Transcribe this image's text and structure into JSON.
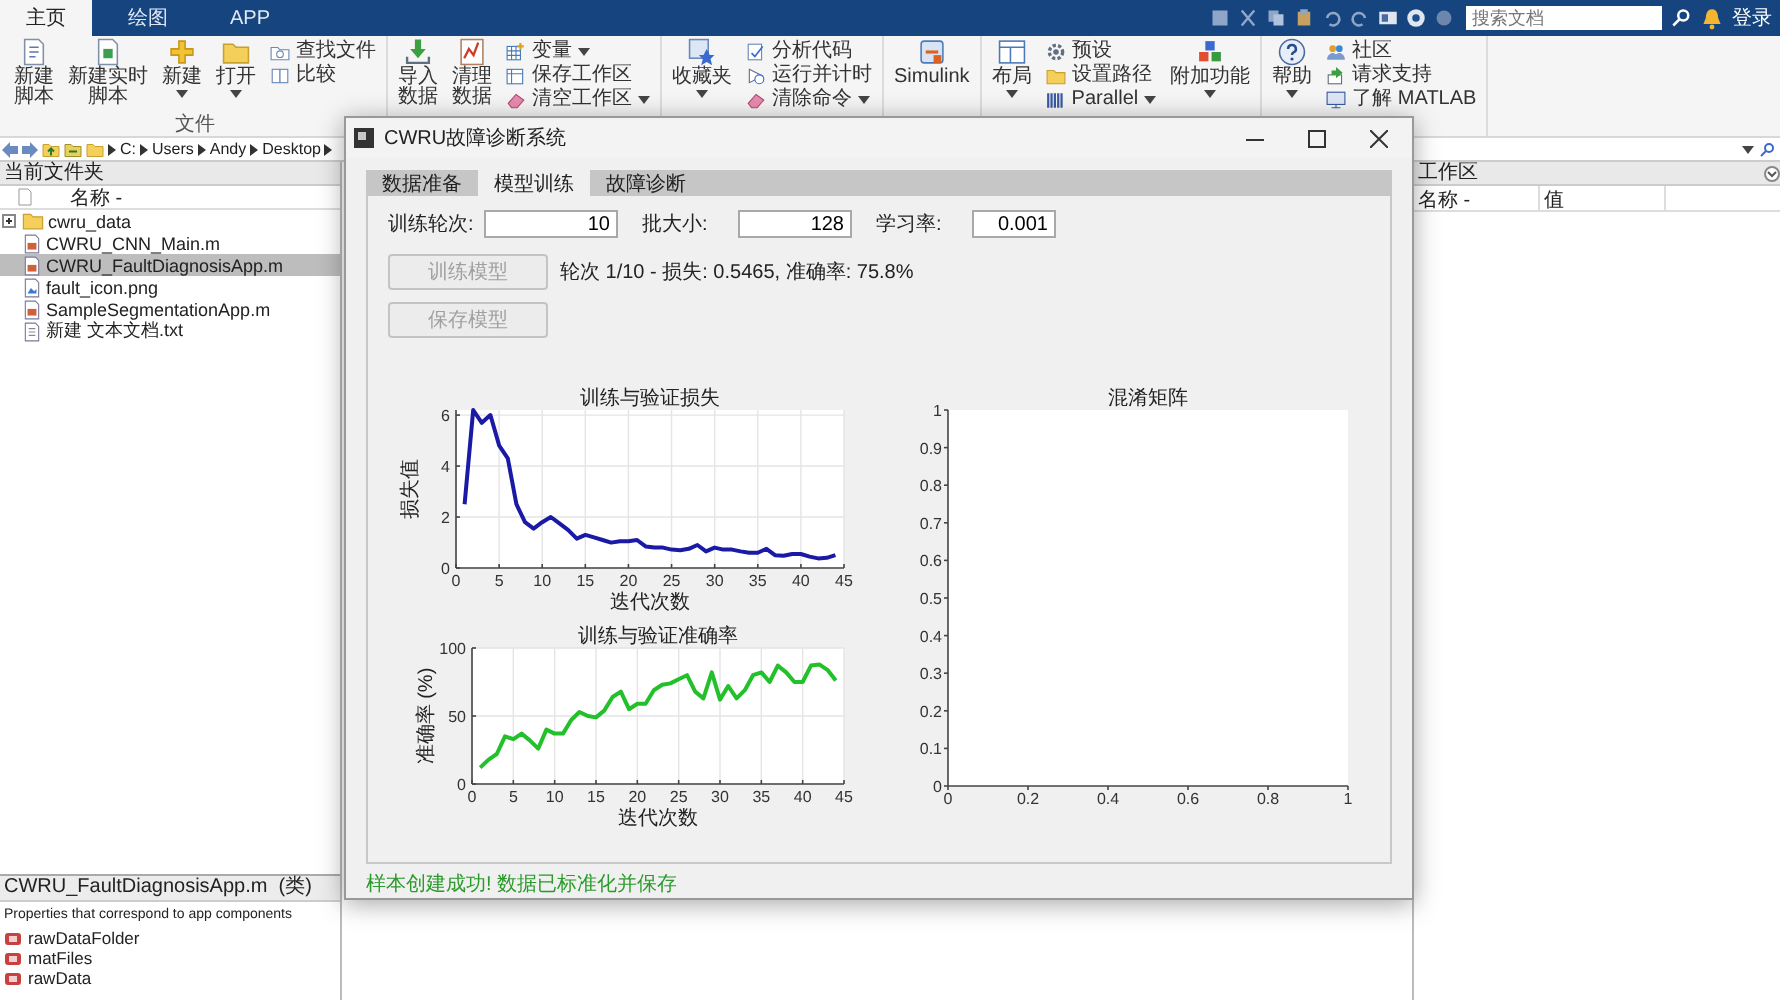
{
  "top_tabs": [
    {
      "label": "主页",
      "selected": true
    },
    {
      "label": "绘图",
      "selected": false
    },
    {
      "label": "APP",
      "selected": false
    }
  ],
  "search": {
    "placeholder": "搜索文档"
  },
  "sign_in": "登录",
  "ribbon": {
    "groups": [
      {
        "label": "文件",
        "items": [
          {
            "kind": "large",
            "label": "新建脚本",
            "dropdown": false
          },
          {
            "kind": "large",
            "label": "新建实时脚本",
            "dropdown": false
          },
          {
            "kind": "large",
            "label": "新建",
            "dropdown": true
          },
          {
            "kind": "large",
            "label": "打开",
            "dropdown": true
          },
          {
            "kind": "stack",
            "items": [
              {
                "label": "查找文件",
                "dropdown": false
              },
              {
                "label": "比较",
                "dropdown": false
              }
            ]
          }
        ]
      },
      {
        "items": [
          {
            "kind": "large",
            "label": "导入数据",
            "dropdown": false
          },
          {
            "kind": "large",
            "label": "清理数据",
            "dropdown": false
          },
          {
            "kind": "stack",
            "items": [
              {
                "label": "变量",
                "dropdown": true
              },
              {
                "label": "保存工作区",
                "dropdown": false
              },
              {
                "label": "清空工作区",
                "dropdown": true
              }
            ]
          }
        ]
      },
      {
        "items": [
          {
            "kind": "large",
            "label": "收藏夹",
            "dropdown": true
          },
          {
            "kind": "stack",
            "items": [
              {
                "label": "分析代码",
                "dropdown": false
              },
              {
                "label": "运行并计时",
                "dropdown": false
              },
              {
                "label": "清除命令",
                "dropdown": true
              }
            ]
          }
        ]
      },
      {
        "items": [
          {
            "kind": "large",
            "label": "Simulink",
            "dropdown": false
          }
        ]
      },
      {
        "items": [
          {
            "kind": "large",
            "label": "布局",
            "dropdown": true
          },
          {
            "kind": "stack",
            "items": [
              {
                "label": "预设",
                "dropdown": false
              },
              {
                "label": "设置路径",
                "dropdown": false
              },
              {
                "label": "Parallel",
                "dropdown": true
              }
            ]
          },
          {
            "kind": "large",
            "label": "附加功能",
            "dropdown": true
          }
        ]
      },
      {
        "items": [
          {
            "kind": "large",
            "label": "帮助",
            "dropdown": true
          },
          {
            "kind": "stack",
            "items": [
              {
                "label": "社区",
                "dropdown": false
              },
              {
                "label": "请求支持",
                "dropdown": false
              },
              {
                "label": "了解 MATLAB",
                "dropdown": false
              }
            ]
          }
        ]
      }
    ]
  },
  "address": [
    "C:",
    "Users",
    "Andy",
    "Desktop"
  ],
  "current_folder": {
    "title": "当前文件夹",
    "column": "名称 -",
    "files": [
      {
        "kind": "folder",
        "name": "cwru_data",
        "expanded": false,
        "selected": false
      },
      {
        "kind": "m",
        "name": "CWRU_CNN_Main.m",
        "selected": false
      },
      {
        "kind": "m",
        "name": "CWRU_FaultDiagnosisApp.m",
        "selected": true
      },
      {
        "kind": "png",
        "name": "fault_icon.png",
        "selected": false
      },
      {
        "kind": "m",
        "name": "SampleSegmentationApp.m",
        "selected": false
      },
      {
        "kind": "txt",
        "name": "新建 文本文档.txt",
        "selected": false
      }
    ]
  },
  "details": {
    "title": "CWRU_FaultDiagnosisApp.m  (类)",
    "description": "Properties that correspond to app components",
    "properties": [
      "rawDataFolder",
      "matFiles",
      "rawData"
    ]
  },
  "workspace": {
    "title": "工作区",
    "columns": [
      "名称 -",
      "值"
    ]
  },
  "app": {
    "title": "CWRU故障诊断系统",
    "tabs": [
      {
        "label": "数据准备",
        "selected": false
      },
      {
        "label": "模型训练",
        "selected": true
      },
      {
        "label": "故障诊断",
        "selected": false
      }
    ],
    "fields": [
      {
        "label": "训练轮次:",
        "value": "10"
      },
      {
        "label": "批大小:",
        "value": "128"
      },
      {
        "label": "学习率:",
        "value": "0.001"
      }
    ],
    "buttons": [
      {
        "label": "训练模型",
        "disabled": true
      },
      {
        "label": "保存模型",
        "disabled": true
      }
    ],
    "progress": "轮次 1/10 - 损失: 0.5465, 准确率: 75.8%",
    "charts": [
      {
        "chart_data": {
          "type": "line",
          "grid": true,
          "title": "训练与验证损失",
          "xlabel": "迭代次数",
          "ylabel": "损失值",
          "xlim": [
            0,
            45
          ],
          "ylim": [
            0,
            6.2
          ],
          "xticks": [
            0,
            5,
            10,
            15,
            20,
            25,
            30,
            35,
            40,
            45
          ],
          "yticks": [
            0,
            2,
            4,
            6
          ],
          "x": [
            1,
            2,
            3,
            4,
            5,
            6,
            7,
            8,
            9,
            10,
            11,
            12,
            13,
            14,
            15,
            16,
            17,
            18,
            19,
            20,
            21,
            22,
            23,
            24,
            25,
            26,
            27,
            28,
            29,
            30,
            31,
            32,
            33,
            34,
            35,
            36,
            37,
            38,
            39,
            40,
            41,
            42,
            43,
            44
          ],
          "series": [
            {
              "color": "#1a1aa6",
              "values": [
                2.5,
                6.2,
                5.7,
                6.0,
                4.8,
                4.3,
                2.5,
                1.8,
                1.55,
                1.8,
                2.0,
                1.75,
                1.5,
                1.15,
                1.3,
                1.2,
                1.1,
                1.0,
                1.05,
                1.05,
                1.1,
                0.85,
                0.8,
                0.8,
                0.72,
                0.7,
                0.75,
                0.9,
                0.65,
                0.8,
                0.72,
                0.72,
                0.65,
                0.6,
                0.6,
                0.75,
                0.5,
                0.48,
                0.55,
                0.55,
                0.45,
                0.38,
                0.4,
                0.5
              ]
            }
          ]
        }
      },
      {
        "chart_data": {
          "type": "line",
          "grid": true,
          "title": "训练与验证准确率",
          "xlabel": "迭代次数",
          "ylabel": "准确率 (%)",
          "xlim": [
            0,
            45
          ],
          "ylim": [
            0,
            100
          ],
          "xticks": [
            0,
            5,
            10,
            15,
            20,
            25,
            30,
            35,
            40,
            45
          ],
          "yticks": [
            0,
            50,
            100
          ],
          "x": [
            1,
            2,
            3,
            4,
            5,
            6,
            7,
            8,
            9,
            10,
            11,
            12,
            13,
            14,
            15,
            16,
            17,
            18,
            19,
            20,
            21,
            22,
            23,
            24,
            25,
            26,
            27,
            28,
            29,
            30,
            31,
            32,
            33,
            34,
            35,
            36,
            37,
            38,
            39,
            40,
            41,
            42,
            43,
            44
          ],
          "series": [
            {
              "color": "#22c02a",
              "values": [
                12,
                18,
                22,
                35,
                33,
                37,
                32,
                26,
                40,
                37,
                37,
                47,
                53,
                50,
                49,
                54,
                64,
                68,
                55,
                59,
                59,
                69,
                73,
                74,
                77,
                80,
                68,
                63,
                82,
                62,
                72,
                63,
                69,
                80,
                82,
                75,
                87,
                82,
                75,
                75,
                87,
                88,
                84,
                76
              ]
            }
          ]
        }
      },
      {
        "chart_data": {
          "type": "heatmap",
          "title": "混淆矩阵",
          "xlim": [
            0,
            1
          ],
          "ylim": [
            0,
            1
          ],
          "xticks": [
            0,
            0.2,
            0.4,
            0.6,
            0.8,
            1
          ],
          "yticks": [
            0,
            0.1,
            0.2,
            0.3,
            0.4,
            0.5,
            0.6,
            0.7,
            0.8,
            0.9,
            1
          ]
        }
      }
    ],
    "status": "样本创建成功! 数据已标准化并保存"
  }
}
